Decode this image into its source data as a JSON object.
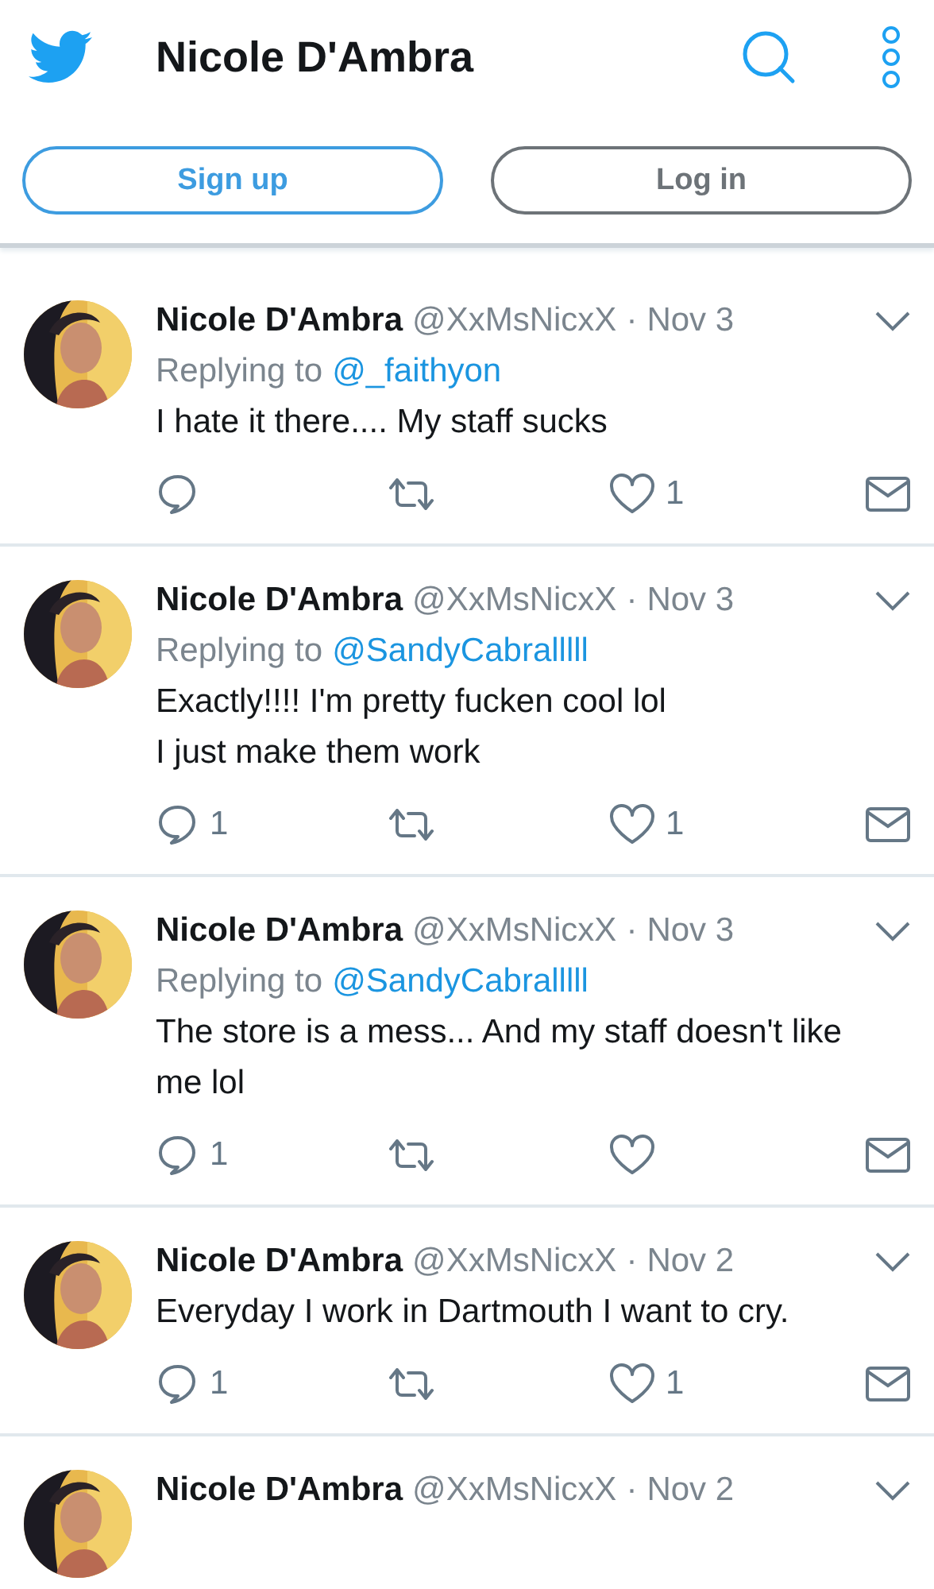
{
  "header": {
    "title": "Nicole D'Ambra"
  },
  "buttons": [
    {
      "label": "Sign up",
      "kind": "primary"
    },
    {
      "label": "Log in",
      "kind": "secondary"
    }
  ],
  "tweets": [
    {
      "name": "Nicole D'Ambra",
      "handle": "@XxMsNicxX",
      "separator": "·",
      "date": "Nov 3",
      "reply_prefix": "Replying to",
      "reply_to": "@_faithyon",
      "lines": [
        "I hate it there.... My staff sucks"
      ],
      "likes": "1"
    },
    {
      "name": "Nicole D'Ambra",
      "handle": "@XxMsNicxX",
      "separator": "·",
      "date": "Nov 3",
      "reply_prefix": "Replying to",
      "reply_to": "@SandyCabralllll",
      "lines": [
        "Exactly!!!! I'm pretty fucken cool lol",
        "I just make them work"
      ],
      "replies": "1",
      "likes": "1"
    },
    {
      "name": "Nicole D'Ambra",
      "handle": "@XxMsNicxX",
      "separator": "·",
      "date": "Nov 3",
      "reply_prefix": "Replying to",
      "reply_to": "@SandyCabralllll",
      "lines": [
        "The store is a mess...  And my staff doesn't like me lol"
      ],
      "replies": "1"
    },
    {
      "name": "Nicole D'Ambra",
      "handle": "@XxMsNicxX",
      "separator": "·",
      "date": "Nov 2",
      "lines": [
        "Everyday I work in Dartmouth I want to cry."
      ],
      "replies": "1",
      "likes": "1"
    },
    {
      "name": "Nicole D'Ambra",
      "handle": "@XxMsNicxX",
      "separator": "·",
      "date": "Nov 2"
    }
  ]
}
